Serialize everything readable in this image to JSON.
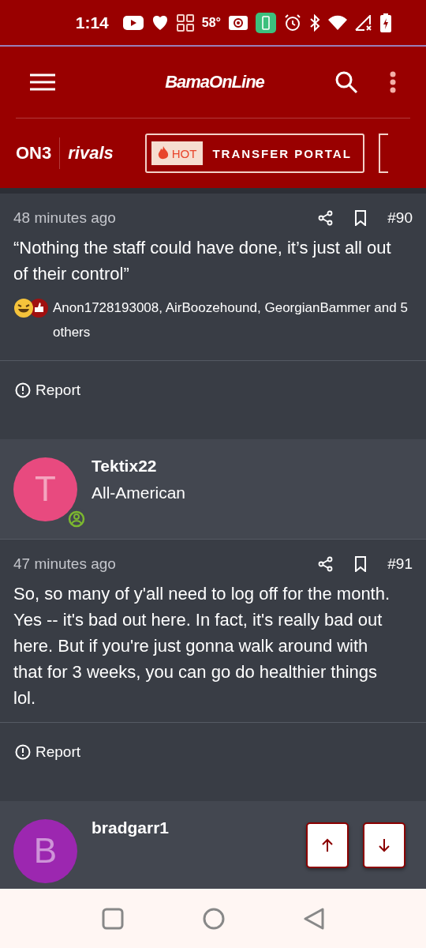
{
  "status_bar": {
    "time": "1:14",
    "temperature": "58°"
  },
  "header": {
    "logo": "BamaOnLine"
  },
  "subnav": {
    "brand": "ON3",
    "partner": "rivals",
    "badge": "HOT",
    "link": "TRANSFER PORTAL"
  },
  "thread": [
    {
      "kind": "post",
      "time": "48 minutes ago",
      "number": "#90",
      "body": "“Nothing the staff could have done, it’s just all out of their control”",
      "reactions": "Anon1728193008, AirBoozehound, GeorgianBammer and 5 others",
      "report": "Report"
    },
    {
      "kind": "author",
      "initial": "T",
      "name": "Tektix22",
      "rank": "All-American",
      "color": "#e84a7f",
      "online": true
    },
    {
      "kind": "post",
      "time": "47 minutes ago",
      "number": "#91",
      "body": "So, so many of y'all need to log off for the month. Yes -- it's bad out here. In fact, it's really bad out here. But if you're just gonna walk around with that for 3 weeks, you can go do healthier things lol.",
      "report": "Report"
    },
    {
      "kind": "author",
      "initial": "B",
      "name": "bradgarr1",
      "color": "#9c27b0",
      "online": false
    }
  ]
}
